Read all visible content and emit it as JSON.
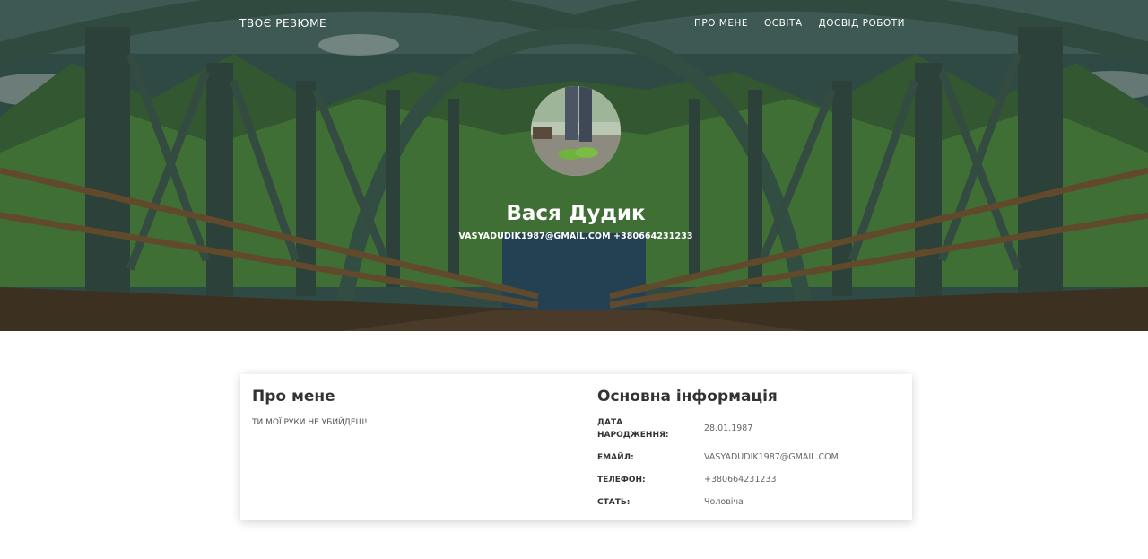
{
  "nav": {
    "brand": "ТВОЄ РЕЗЮМЕ",
    "links": [
      "ПРО МЕНЕ",
      "ОСВІТА",
      "ДОСВІД РОБОТИ"
    ]
  },
  "profile": {
    "name": "Вася Дудик",
    "contact": "VASYADUDIK1987@GMAIL.COM +380664231233"
  },
  "about": {
    "title": "Про мене",
    "text": "ТИ МОЇ РУКИ НЕ УБИЙДЕШ!"
  },
  "info": {
    "title": "Основна інформація",
    "rows": [
      {
        "label": "ДАТА НАРОДЖЕННЯ:",
        "value": "28.01.1987"
      },
      {
        "label": "ЕМАЙЛ:",
        "value": "VASYADUDIK1987@GMAIL.COM"
      },
      {
        "label": "ТЕЛЕФОН:",
        "value": "+380664231233"
      },
      {
        "label": "СТАТЬ:",
        "value": "Чоловіча"
      }
    ]
  },
  "colors": {
    "hero_overlay": "#2f4f4a",
    "card_bg": "#ffffff",
    "text_dark": "#333333"
  }
}
